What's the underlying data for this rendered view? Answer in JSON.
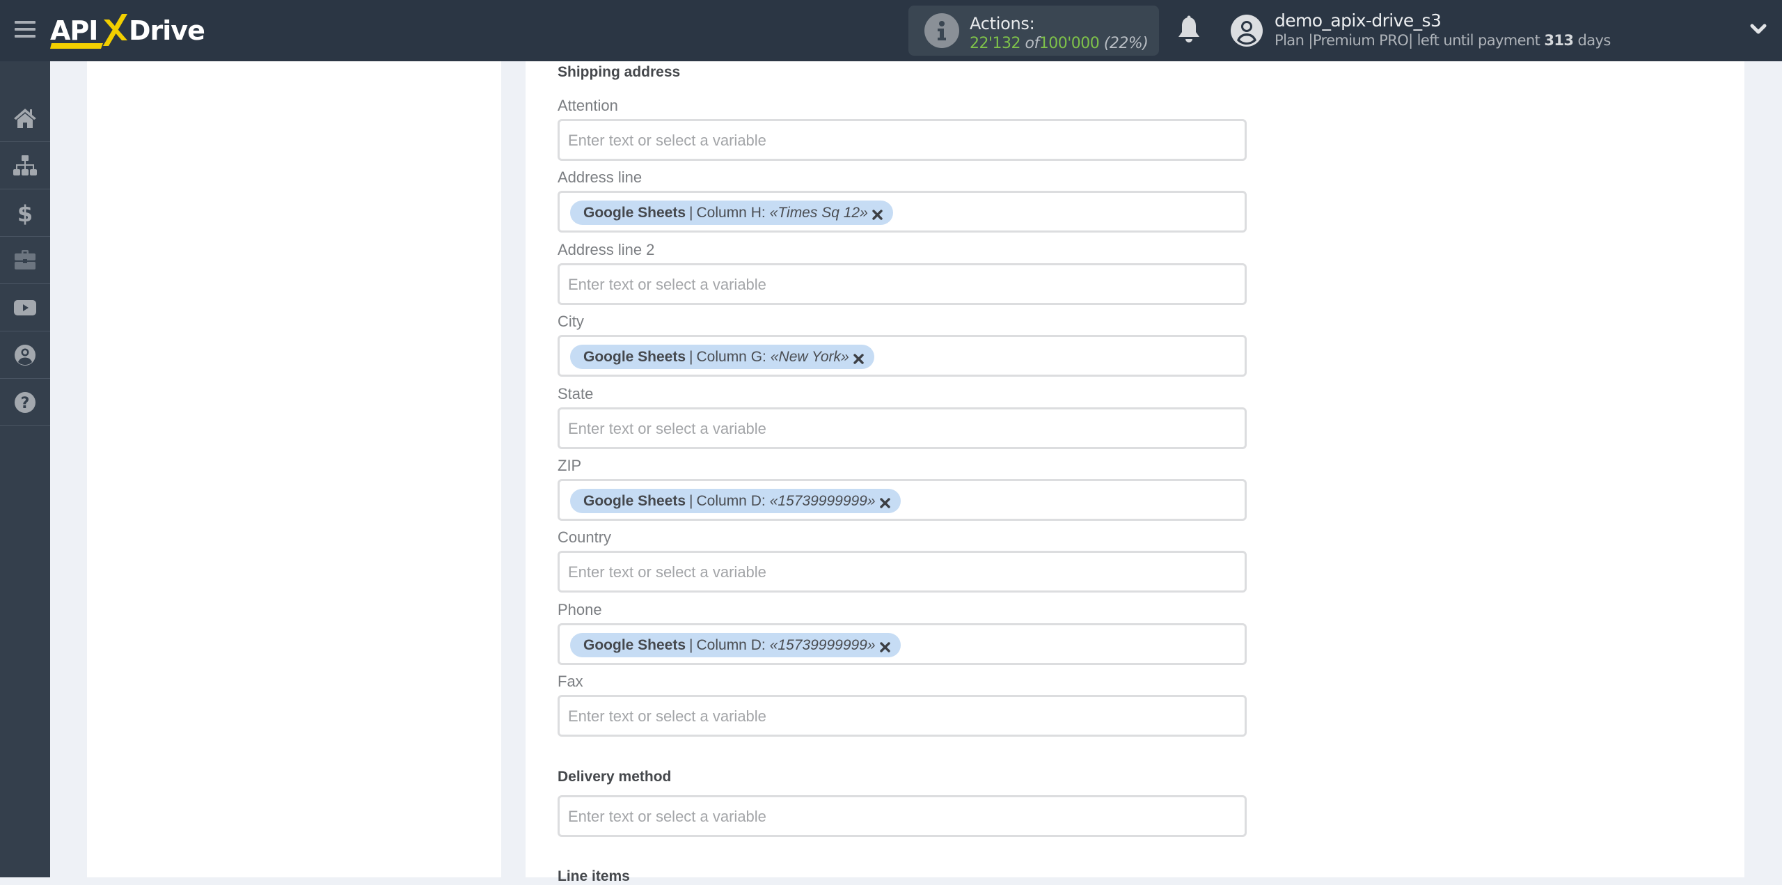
{
  "header": {
    "brand": {
      "api": "API",
      "x": "X",
      "drive": "Drive",
      "accent_color": "#f2cf00"
    },
    "actions": {
      "label": "Actions:",
      "used": "22'132",
      "of": "of",
      "total": "100'000",
      "percent": "(22%)",
      "usage_fraction": 0.22
    },
    "user": {
      "name": "demo_apix-drive_s3",
      "plan_prefix": "Plan |Premium PRO| left until payment",
      "days": "313",
      "days_suffix": "days"
    }
  },
  "sidebar": {
    "items": [
      {
        "name": "home",
        "icon": "home-icon"
      },
      {
        "name": "connections",
        "icon": "sitemap-icon"
      },
      {
        "name": "billing",
        "icon": "dollar-icon"
      },
      {
        "name": "tools",
        "icon": "briefcase-icon"
      },
      {
        "name": "video",
        "icon": "youtube-icon"
      },
      {
        "name": "account",
        "icon": "user-circle-icon"
      },
      {
        "name": "help",
        "icon": "question-circle-icon"
      }
    ]
  },
  "form": {
    "shipping_title": "Shipping address",
    "placeholder": "Enter text or select a variable",
    "fields": [
      {
        "label": "Attention",
        "value": null
      },
      {
        "label": "Address line",
        "value": {
          "source": "Google Sheets",
          "column": "Column H:",
          "sample": "«Times Sq 12»"
        }
      },
      {
        "label": "Address line 2",
        "value": null
      },
      {
        "label": "City",
        "value": {
          "source": "Google Sheets",
          "column": "Column G:",
          "sample": "«New York»"
        }
      },
      {
        "label": "State",
        "value": null
      },
      {
        "label": "ZIP",
        "value": {
          "source": "Google Sheets",
          "column": "Column D:",
          "sample": "«15739999999»"
        }
      },
      {
        "label": "Country",
        "value": null
      },
      {
        "label": "Phone",
        "value": {
          "source": "Google Sheets",
          "column": "Column D:",
          "sample": "«15739999999»"
        }
      },
      {
        "label": "Fax",
        "value": null
      }
    ],
    "chip_separator": "|",
    "delivery_title": "Delivery method",
    "line_items_title": "Line items"
  }
}
